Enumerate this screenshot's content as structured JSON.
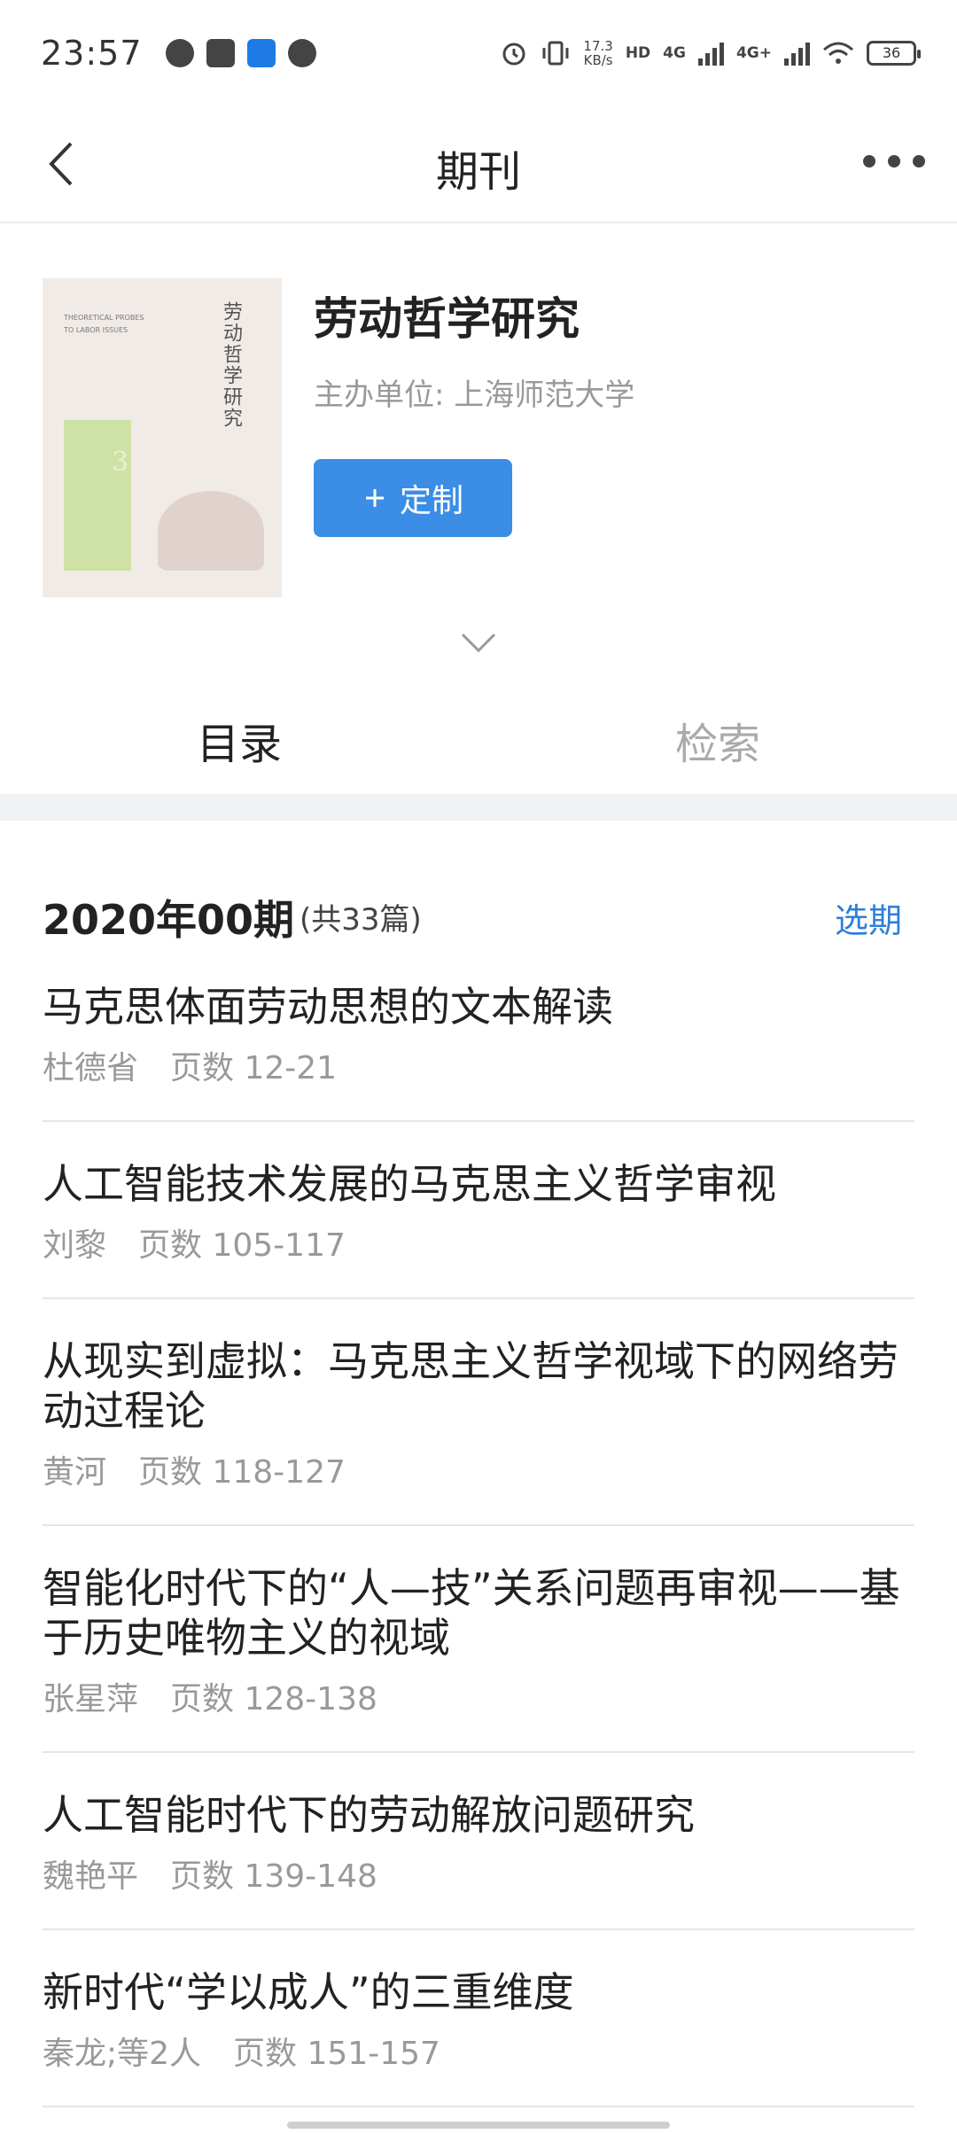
{
  "status_bar": {
    "time": "23:57",
    "net_speed_value": "17.3",
    "net_speed_unit": "KB/s",
    "hd_label": "HD",
    "net1": "4G",
    "net2": "4G+",
    "battery": "36",
    "icons": [
      "wechat-icon",
      "mail-icon",
      "app-icon",
      "message-icon",
      "alarm-icon",
      "vibrate-icon",
      "signal-icon",
      "wifi-icon",
      "battery-icon"
    ]
  },
  "nav": {
    "title": "期刊"
  },
  "journal": {
    "name": "劳动哲学研究",
    "sponsor": "主办单位: 上海师范大学",
    "subscribe_label": "定制",
    "cover_title": "劳动哲学研究",
    "cover_en": "THEORETICAL PROBES TO LABOR ISSUES",
    "cover_issue": "3"
  },
  "tabs": [
    {
      "label": "目录",
      "active": true
    },
    {
      "label": "检索",
      "active": false
    }
  ],
  "issue": {
    "title": "2020年00期",
    "count": "(共33篇)",
    "select_label": "选期"
  },
  "articles": [
    {
      "title": "马克思体面劳动思想的文本解读",
      "author": "杜德省",
      "pages": "页数 12-21"
    },
    {
      "title": "人工智能技术发展的马克思主义哲学审视",
      "author": "刘黎",
      "pages": "页数 105-117"
    },
    {
      "title": "从现实到虚拟：马克思主义哲学视域下的网络劳动过程论",
      "author": "黄河",
      "pages": "页数 118-127"
    },
    {
      "title": "智能化时代下的“人—技”关系问题再审视——基于历史唯物主义的视域",
      "author": "张星萍",
      "pages": "页数 128-138"
    },
    {
      "title": "人工智能时代下的劳动解放问题研究",
      "author": "魏艳平",
      "pages": "页数 139-148"
    },
    {
      "title": "新时代“学以成人”的三重维度",
      "author": "秦龙;等2人",
      "pages": "页数 151-157"
    }
  ],
  "colors": {
    "accent": "#3b8de6",
    "link": "#2f7fd6",
    "muted": "#999999"
  }
}
